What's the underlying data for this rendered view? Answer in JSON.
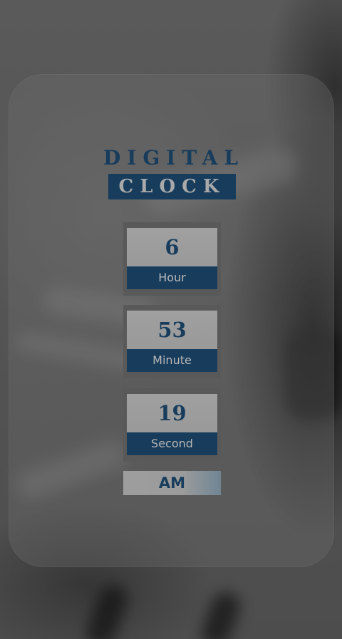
{
  "title": {
    "line1": "DIGITAL",
    "line2": "CLOCK"
  },
  "clock": {
    "hour": {
      "value": "6",
      "label": "Hour"
    },
    "minute": {
      "value": "53",
      "label": "Minute"
    },
    "second": {
      "value": "19",
      "label": "Second"
    },
    "period": "AM"
  },
  "colors": {
    "accent": "#173c5c",
    "tile": "#9c9c9c",
    "tile_frame": "#595959"
  }
}
